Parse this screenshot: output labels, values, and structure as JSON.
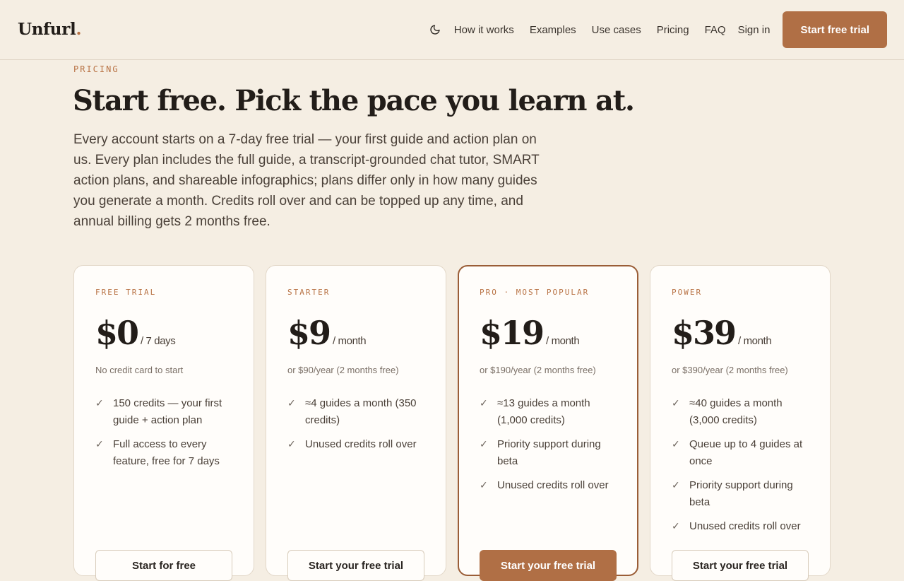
{
  "brand": {
    "name": "Unfurl",
    "dot": "."
  },
  "nav": {
    "theme_icon": "moon-icon",
    "links": [
      "How it works",
      "Examples",
      "Use cases",
      "Pricing",
      "FAQ"
    ],
    "signin": "Sign in",
    "cta": "Start free trial"
  },
  "hero": {
    "eyebrow": "PRICING",
    "title": "Start free. Pick the pace you learn at.",
    "intro": "Every account starts on a 7-day free trial — your first guide and action plan on us. Every plan includes the full guide, a transcript-grounded chat tutor, SMART action plans, and shareable infographics; plans differ only in how many guides you generate a month. Credits roll over and can be topped up any time, and annual billing gets 2 months free."
  },
  "plans": [
    {
      "name": "FREE TRIAL",
      "price": "$0",
      "period": "/ 7 days",
      "note": "No credit card to start",
      "features": [
        "150 credits — your first guide + action plan",
        "Full access to every feature, free for 7 days"
      ],
      "button": "Start for free"
    },
    {
      "name": "STARTER",
      "price": "$9",
      "period": "/ month",
      "note": "or $90/year (2 months free)",
      "features": [
        "≈4 guides a month (350 credits)",
        "Unused credits roll over"
      ],
      "button": "Start your free trial"
    },
    {
      "name": "PRO · MOST POPULAR",
      "price": "$19",
      "period": "/ month",
      "note": "or $190/year (2 months free)",
      "features": [
        "≈13 guides a month (1,000 credits)",
        "Priority support during beta",
        "Unused credits roll over"
      ],
      "button": "Start your free trial"
    },
    {
      "name": "POWER",
      "price": "$39",
      "period": "/ month",
      "note": "or $390/year (2 months free)",
      "features": [
        "≈40 guides a month (3,000 credits)",
        "Queue up to 4 guides at once",
        "Priority support during beta",
        "Unused credits roll over"
      ],
      "button": "Start your free trial"
    }
  ],
  "check_icon": "✓",
  "colors": {
    "accent": "#b06f45",
    "background": "#f5eee3",
    "featured_border": "#9a5d37"
  }
}
